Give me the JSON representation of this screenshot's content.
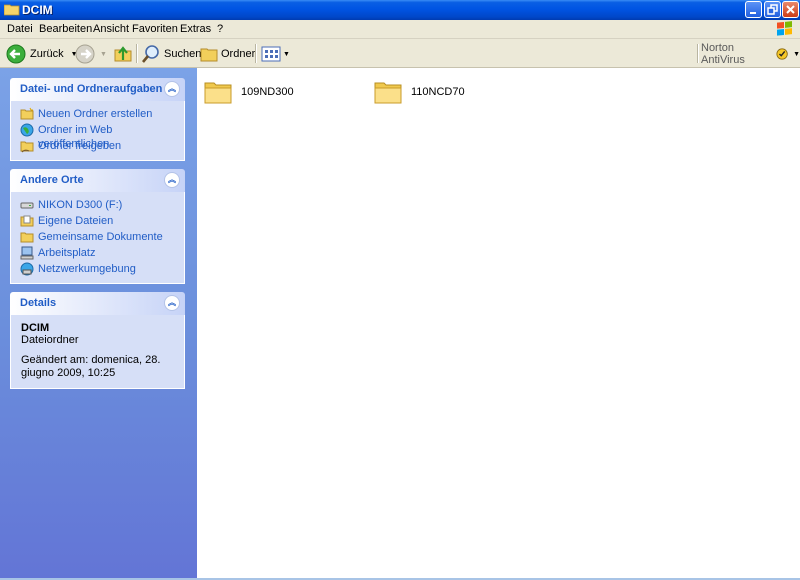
{
  "window": {
    "title": "DCIM"
  },
  "menubar": {
    "items": [
      {
        "label": "Datei"
      },
      {
        "label": "Bearbeiten"
      },
      {
        "label": "Ansicht"
      },
      {
        "label": "Favoriten"
      },
      {
        "label": "Extras"
      },
      {
        "label": "?"
      }
    ]
  },
  "toolbar": {
    "back_label": "Zurück",
    "search_label": "Suchen",
    "folders_label": "Ordner",
    "norton_label": "Norton AntiVirus"
  },
  "taskpane": {
    "file_tasks": {
      "title": "Datei- und Ordneraufgaben",
      "items": [
        {
          "label": "Neuen Ordner erstellen",
          "icon": "new-folder-icon"
        },
        {
          "label": "Ordner im Web veröffentlichen",
          "icon": "web-publish-icon"
        },
        {
          "label": "Ordner freigeben",
          "icon": "share-folder-icon"
        }
      ]
    },
    "other_places": {
      "title": "Andere Orte",
      "items": [
        {
          "label": "NIKON D300 (F:)",
          "icon": "drive-icon"
        },
        {
          "label": "Eigene Dateien",
          "icon": "my-documents-icon"
        },
        {
          "label": "Gemeinsame Dokumente",
          "icon": "shared-documents-icon"
        },
        {
          "label": "Arbeitsplatz",
          "icon": "my-computer-icon"
        },
        {
          "label": "Netzwerkumgebung",
          "icon": "network-icon"
        }
      ]
    },
    "details": {
      "title": "Details",
      "name": "DCIM",
      "type": "Dateiordner",
      "modified": "Geändert am: domenica, 28. giugno 2009, 10:25"
    }
  },
  "content": {
    "folders": [
      {
        "name": "109ND300"
      },
      {
        "name": "110NCD70"
      }
    ]
  },
  "colors": {
    "titlebar": "#0054e3",
    "taskpane_top": "#7ba2e7",
    "taskpane_bottom": "#6375d6",
    "link": "#215dc6",
    "chrome": "#ece9d8"
  }
}
